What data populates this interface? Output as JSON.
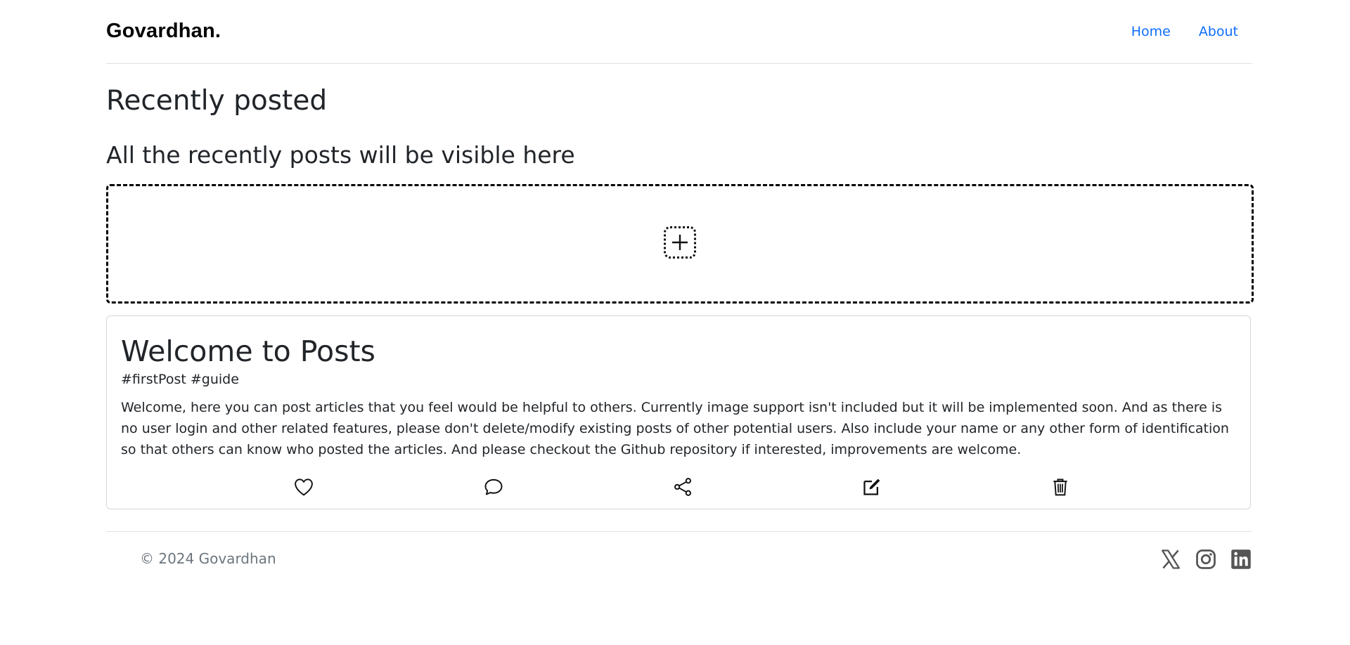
{
  "header": {
    "brand": "Govardhan.",
    "nav": [
      {
        "label": "Home"
      },
      {
        "label": "About"
      }
    ]
  },
  "main": {
    "title": "Recently posted",
    "subtitle": "All the recently posts will be visible here",
    "add_icon": "plus-square-dotted-icon"
  },
  "post": {
    "title": "Welcome to Posts",
    "tags": "#firstPost #guide",
    "body": "Welcome, here you can post articles that you feel would be helpful to others. Currently image support isn't included but it will be implemented soon. And as there is no user login and other related features, please don't delete/modify existing posts of other potential users. Also include your name or any other form of identification so that others can know who posted the articles. And please checkout the Github repository if interested, improvements are welcome.",
    "actions": [
      "heart-icon",
      "comment-icon",
      "share-icon",
      "edit-icon",
      "trash-icon"
    ]
  },
  "footer": {
    "copyright": "© 2024 Govardhan",
    "social": [
      "x-twitter-icon",
      "instagram-icon",
      "linkedin-icon"
    ],
    "icon_color": "#555555"
  },
  "colors": {
    "link": "#0d6efd",
    "text": "#212529",
    "muted": "#6c757d"
  }
}
